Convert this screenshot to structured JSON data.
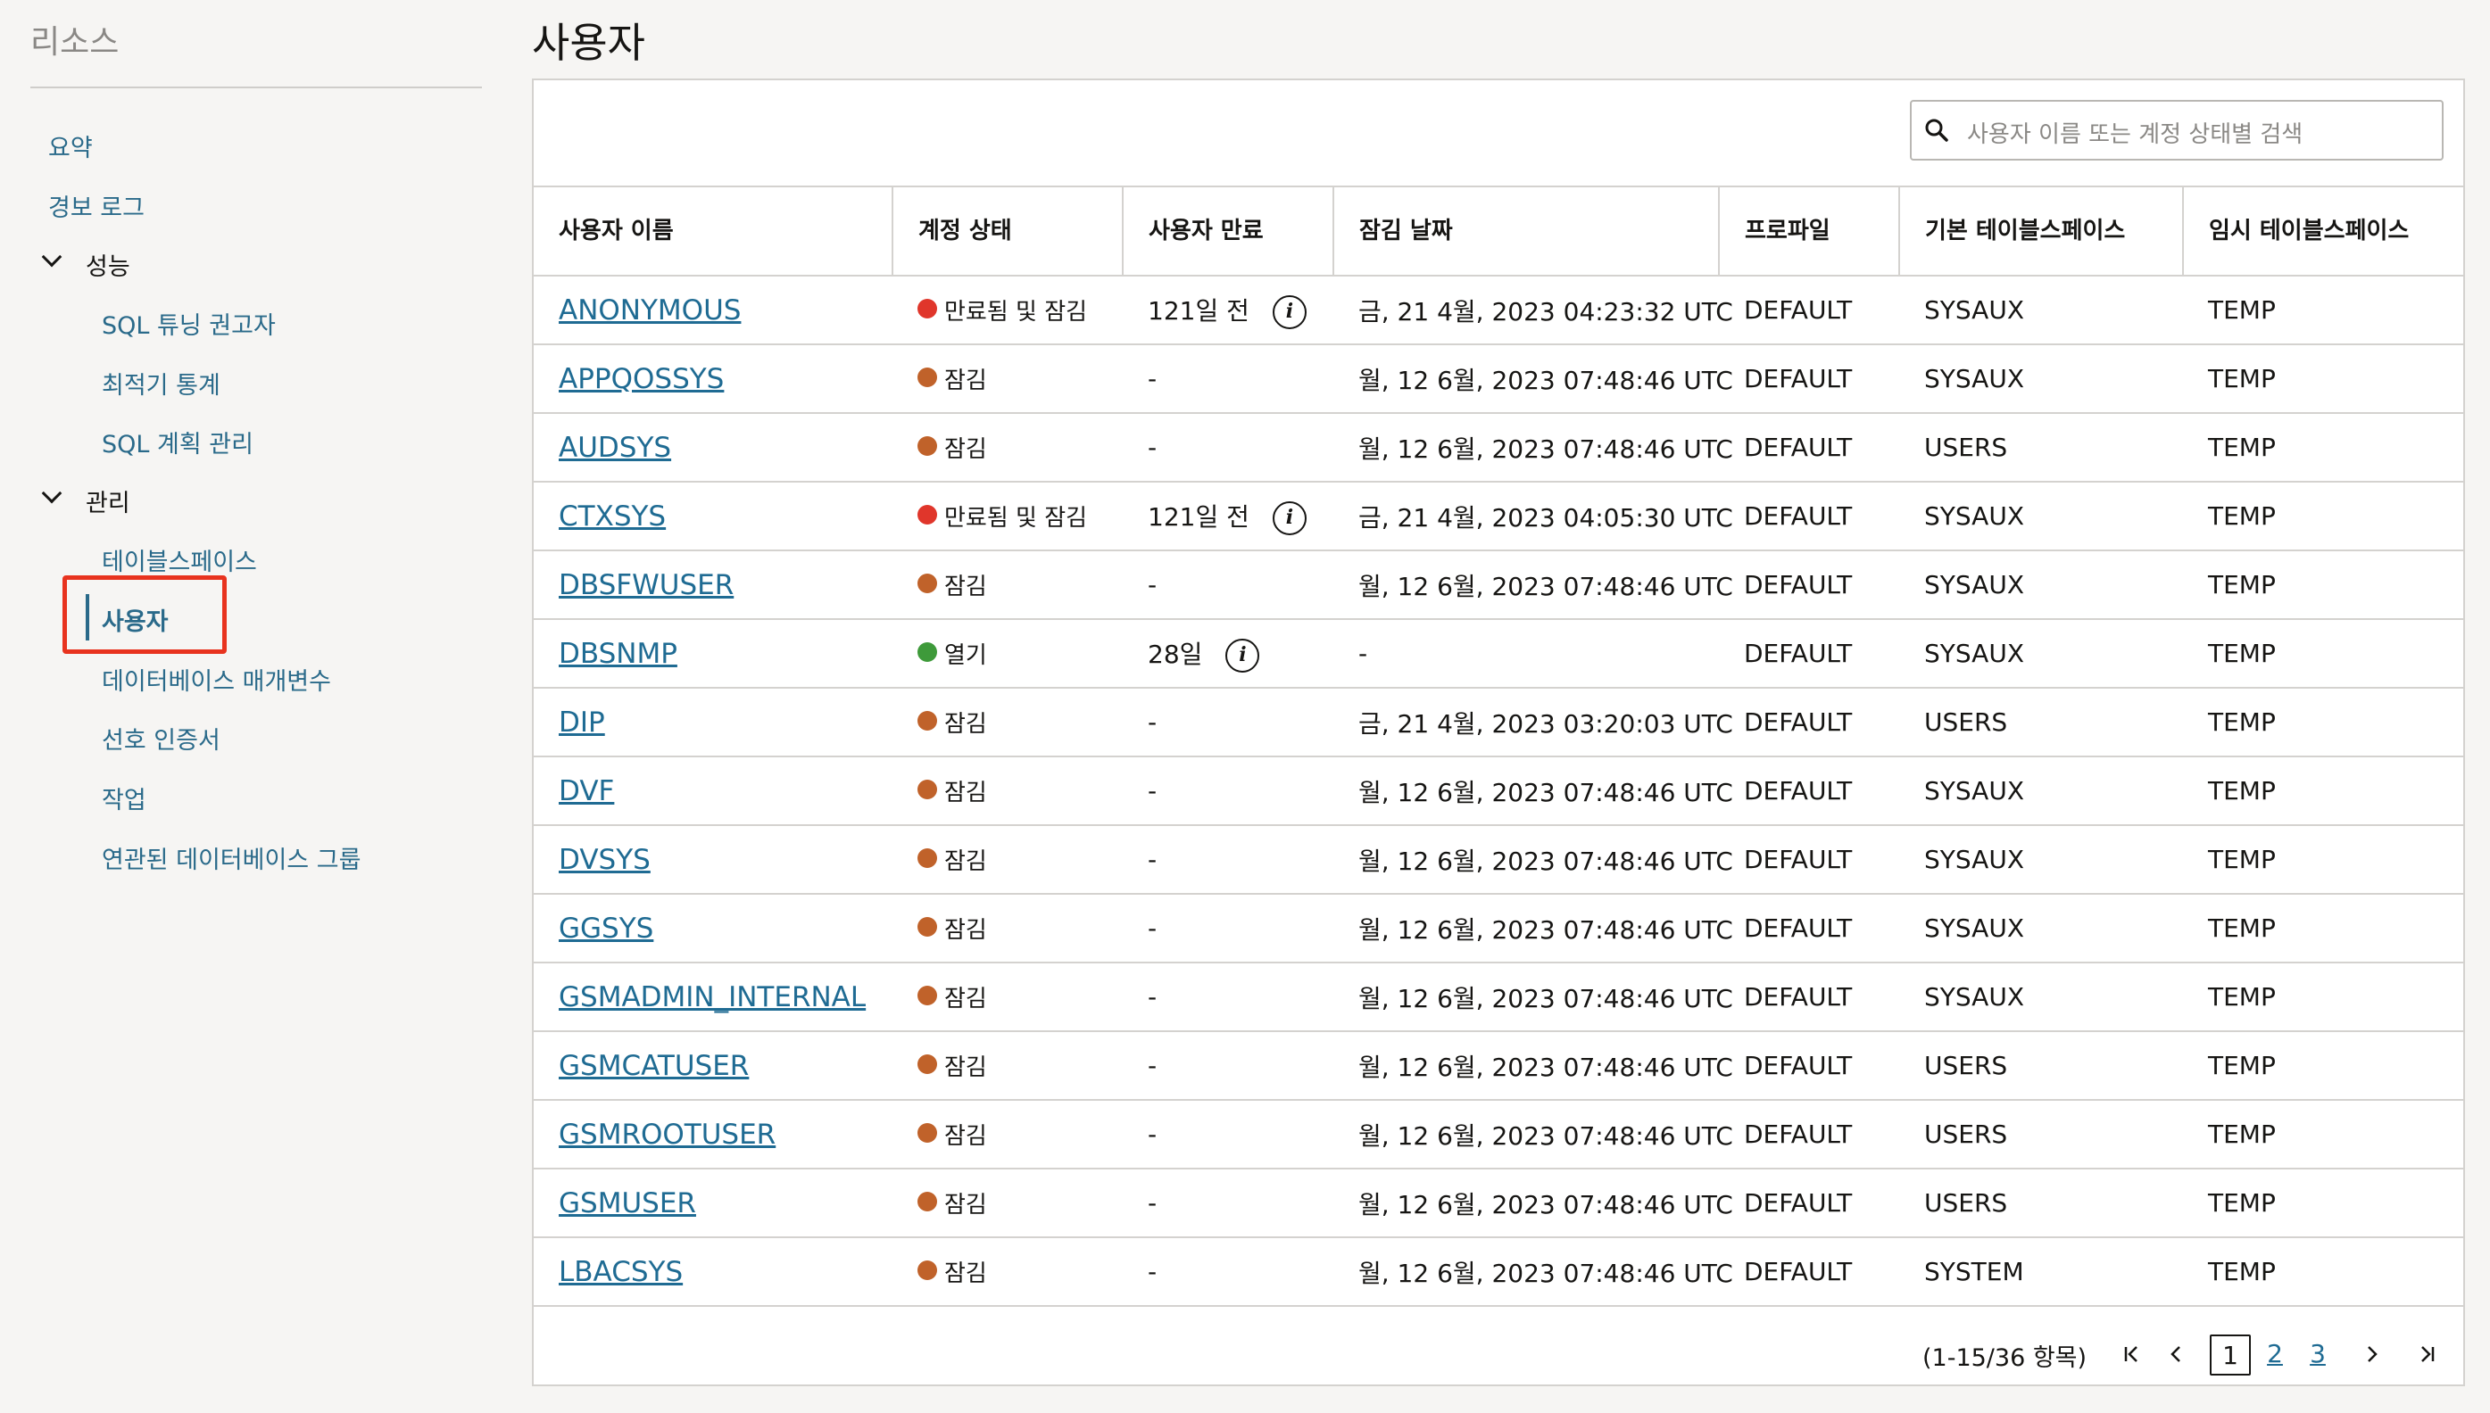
{
  "sidebar": {
    "title": "리소스",
    "items": [
      {
        "label": "요약"
      },
      {
        "label": "경보 로그"
      }
    ],
    "groups": [
      {
        "label": "성능",
        "children": [
          "SQL 튜닝 권고자",
          "최적기 통계",
          "SQL 계획 관리"
        ]
      },
      {
        "label": "관리",
        "children": [
          "테이블스페이스",
          "사용자",
          "데이터베이스 매개변수",
          "선호 인증서",
          "작업",
          "연관된 데이터베이스 그룹"
        ]
      }
    ],
    "selected": "사용자"
  },
  "page": {
    "title": "사용자",
    "search_placeholder": "사용자 이름 또는 계정 상태별 검색"
  },
  "table": {
    "headers": [
      "사용자 이름",
      "계정 상태",
      "사용자 만료",
      "잠김 날짜",
      "프로파일",
      "기본 테이블스페이스",
      "임시 테이블스페이스"
    ],
    "rows": [
      {
        "name": "ANONYMOUS",
        "status": "만료됨 및 잠김",
        "status_color": "#e0362b",
        "expiry": "121일 전",
        "info": true,
        "locked": "금, 21 4월, 2023 04:23:32 UTC",
        "profile": "DEFAULT",
        "default_ts": "SYSAUX",
        "temp_ts": "TEMP"
      },
      {
        "name": "APPQOSSYS",
        "status": "잠김",
        "status_color": "#c0622a",
        "expiry": "-",
        "info": false,
        "locked": "월, 12 6월, 2023 07:48:46 UTC",
        "profile": "DEFAULT",
        "default_ts": "SYSAUX",
        "temp_ts": "TEMP"
      },
      {
        "name": "AUDSYS",
        "status": "잠김",
        "status_color": "#c0622a",
        "expiry": "-",
        "info": false,
        "locked": "월, 12 6월, 2023 07:48:46 UTC",
        "profile": "DEFAULT",
        "default_ts": "USERS",
        "temp_ts": "TEMP"
      },
      {
        "name": "CTXSYS",
        "status": "만료됨 및 잠김",
        "status_color": "#e0362b",
        "expiry": "121일 전",
        "info": true,
        "locked": "금, 21 4월, 2023 04:05:30 UTC",
        "profile": "DEFAULT",
        "default_ts": "SYSAUX",
        "temp_ts": "TEMP"
      },
      {
        "name": "DBSFWUSER",
        "status": "잠김",
        "status_color": "#c0622a",
        "expiry": "-",
        "info": false,
        "locked": "월, 12 6월, 2023 07:48:46 UTC",
        "profile": "DEFAULT",
        "default_ts": "SYSAUX",
        "temp_ts": "TEMP"
      },
      {
        "name": "DBSNMP",
        "status": "열기",
        "status_color": "#3e9a3a",
        "expiry": "28일",
        "info": true,
        "locked": "-",
        "profile": "DEFAULT",
        "default_ts": "SYSAUX",
        "temp_ts": "TEMP"
      },
      {
        "name": "DIP",
        "status": "잠김",
        "status_color": "#c0622a",
        "expiry": "-",
        "info": false,
        "locked": "금, 21 4월, 2023 03:20:03 UTC",
        "profile": "DEFAULT",
        "default_ts": "USERS",
        "temp_ts": "TEMP"
      },
      {
        "name": "DVF",
        "status": "잠김",
        "status_color": "#c0622a",
        "expiry": "-",
        "info": false,
        "locked": "월, 12 6월, 2023 07:48:46 UTC",
        "profile": "DEFAULT",
        "default_ts": "SYSAUX",
        "temp_ts": "TEMP"
      },
      {
        "name": "DVSYS",
        "status": "잠김",
        "status_color": "#c0622a",
        "expiry": "-",
        "info": false,
        "locked": "월, 12 6월, 2023 07:48:46 UTC",
        "profile": "DEFAULT",
        "default_ts": "SYSAUX",
        "temp_ts": "TEMP"
      },
      {
        "name": "GGSYS",
        "status": "잠김",
        "status_color": "#c0622a",
        "expiry": "-",
        "info": false,
        "locked": "월, 12 6월, 2023 07:48:46 UTC",
        "profile": "DEFAULT",
        "default_ts": "SYSAUX",
        "temp_ts": "TEMP"
      },
      {
        "name": "GSMADMIN_INTERNAL",
        "status": "잠김",
        "status_color": "#c0622a",
        "expiry": "-",
        "info": false,
        "locked": "월, 12 6월, 2023 07:48:46 UTC",
        "profile": "DEFAULT",
        "default_ts": "SYSAUX",
        "temp_ts": "TEMP"
      },
      {
        "name": "GSMCATUSER",
        "status": "잠김",
        "status_color": "#c0622a",
        "expiry": "-",
        "info": false,
        "locked": "월, 12 6월, 2023 07:48:46 UTC",
        "profile": "DEFAULT",
        "default_ts": "USERS",
        "temp_ts": "TEMP"
      },
      {
        "name": "GSMROOTUSER",
        "status": "잠김",
        "status_color": "#c0622a",
        "expiry": "-",
        "info": false,
        "locked": "월, 12 6월, 2023 07:48:46 UTC",
        "profile": "DEFAULT",
        "default_ts": "USERS",
        "temp_ts": "TEMP"
      },
      {
        "name": "GSMUSER",
        "status": "잠김",
        "status_color": "#c0622a",
        "expiry": "-",
        "info": false,
        "locked": "월, 12 6월, 2023 07:48:46 UTC",
        "profile": "DEFAULT",
        "default_ts": "USERS",
        "temp_ts": "TEMP"
      },
      {
        "name": "LBACSYS",
        "status": "잠김",
        "status_color": "#c0622a",
        "expiry": "-",
        "info": false,
        "locked": "월, 12 6월, 2023 07:48:46 UTC",
        "profile": "DEFAULT",
        "default_ts": "SYSTEM",
        "temp_ts": "TEMP"
      }
    ]
  },
  "pagination": {
    "summary": "(1-15/36 항목)",
    "pages": [
      "1",
      "2",
      "3"
    ],
    "current": "1"
  }
}
